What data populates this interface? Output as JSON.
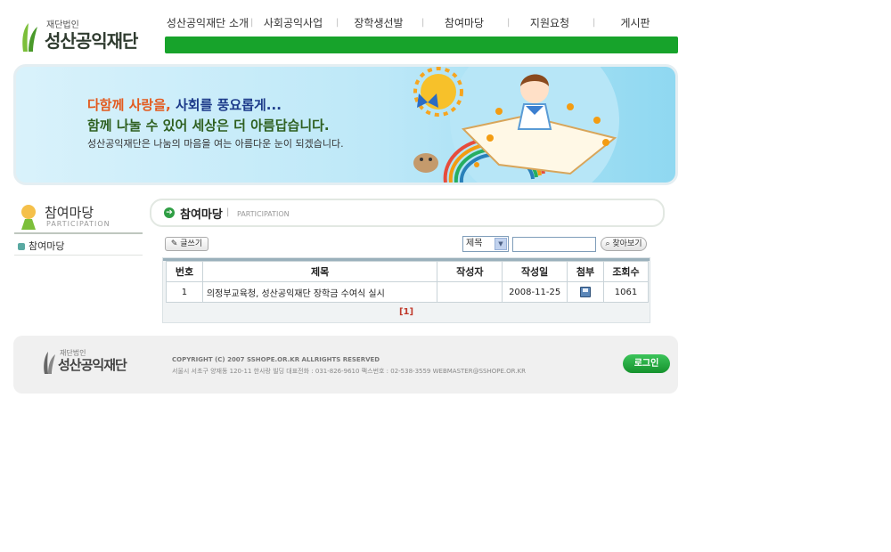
{
  "logo": {
    "small": "재단법인",
    "name": "성산공익재단"
  },
  "nav": {
    "items": [
      "성산공익재단 소개",
      "사회공익사업",
      "장학생선발",
      "참여마당",
      "지원요청",
      "게시판"
    ]
  },
  "banner": {
    "line1_a": "다함께 사랑을,",
    "line1_b": "사회를 풍요롭게...",
    "line2": "함께 나눌 수 있어 세상은 더 아름답습니다.",
    "line3": "성산공익재단은 나눔의 마음을 여는 아름다운 눈이 되겠습니다."
  },
  "sidebar": {
    "title_ko": "참여마당",
    "title_en": "PARTICIPATION",
    "items": [
      {
        "label": "참여마당"
      }
    ]
  },
  "section": {
    "title_ko": "참여마당",
    "sep": "|",
    "title_en": "PARTICIPATION"
  },
  "toolbar": {
    "write_label": "글쓰기",
    "search_field_selected": "제목",
    "search_value": "",
    "search_label": "찾아보기"
  },
  "board": {
    "columns": [
      "번호",
      "제목",
      "작성자",
      "작성일",
      "첨부",
      "조회수"
    ],
    "rows": [
      {
        "no": "1",
        "title": "의정부교육청, 성산공익재단 장학금 수여식 실시",
        "author": "",
        "date": "2008-11-25",
        "attach_icon": "floppy-disk-icon",
        "views": "1061"
      }
    ],
    "pager": "[1]"
  },
  "footer": {
    "logo_small": "재단법인",
    "logo_name": "성산공익재단",
    "copyright": "COPYRIGHT (C) 2007  SSHOPE.OR.KR ALLRIGHTS RESERVED",
    "address": "서울시 서초구 양재동 120-11 한사랑 빌딩     대표전화 : 031-826-9610     팩스번호 : 02-538-3559   WEBMASTER@SSHOPE.OR.KR",
    "login_label": "로그인"
  },
  "colors": {
    "brand_green": "#17a32b",
    "banner_sky": "#8fd8f1"
  }
}
